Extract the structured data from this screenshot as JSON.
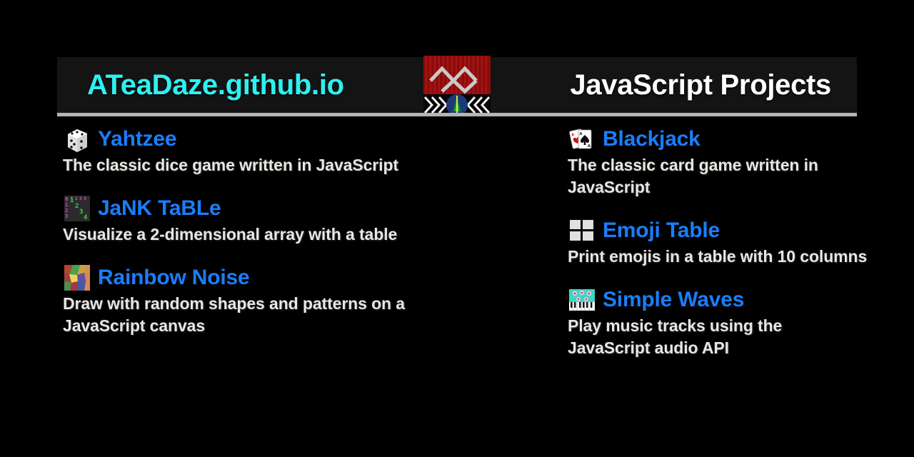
{
  "header": {
    "brand": "ATeaDaze.github.io",
    "title": "JavaScript Projects",
    "brand_color": "#2ff0f0",
    "title_color": "#ffffff",
    "background": "#141414",
    "divider_color": "#b4b4b4",
    "logo_name": "site-logo-mountains-tree"
  },
  "page": {
    "background": "#000000",
    "link_color": "#1a7efa",
    "description_color": "#e6e6e6"
  },
  "columns": {
    "left": [
      {
        "icon": "dice-icon",
        "name": "Yahtzee",
        "description": "The classic dice game written in JavaScript"
      },
      {
        "icon": "jank-table-grid-icon",
        "name": "JaNK TaBLe",
        "description": "Visualize a 2-dimensional array with a table"
      },
      {
        "icon": "rainbow-mosaic-icon",
        "name": "Rainbow Noise",
        "description": "Draw with random shapes and patterns on a JavaScript canvas"
      }
    ],
    "right": [
      {
        "icon": "playing-cards-icon",
        "name": "Blackjack",
        "description": "The classic card game written in JavaScript"
      },
      {
        "icon": "grid-squares-icon",
        "name": "Emoji Table",
        "description": "Print emojis in a table with 10 columns"
      },
      {
        "icon": "synthesizer-icon",
        "name": "Simple Waves",
        "description": "Play music tracks using the JavaScript audio API"
      }
    ]
  }
}
